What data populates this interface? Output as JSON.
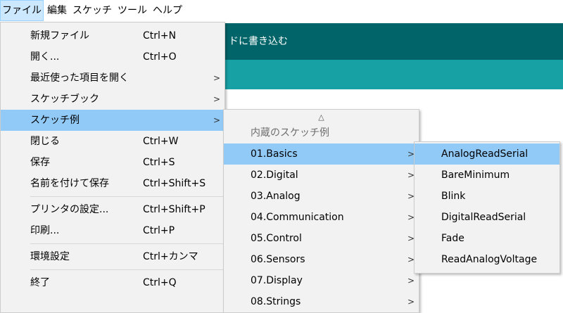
{
  "menubar": {
    "items": [
      {
        "label": "ファイル",
        "active": true
      },
      {
        "label": "編集",
        "active": false
      },
      {
        "label": "スケッチ",
        "active": false
      },
      {
        "label": "ツール",
        "active": false
      },
      {
        "label": "ヘルプ",
        "active": false
      }
    ]
  },
  "app": {
    "toolbar_tooltip": "ドに書き込む",
    "colors": {
      "toolbar": "#006468",
      "tabs": "#17a1a5",
      "highlight": "#91c9f7"
    }
  },
  "file_menu": {
    "items": [
      {
        "label": "新規ファイル",
        "shortcut": "Ctrl+N"
      },
      {
        "label": "開く...",
        "shortcut": "Ctrl+O"
      },
      {
        "label": "最近使った項目を開く",
        "shortcut": "",
        "submenu": true
      },
      {
        "label": "スケッチブック",
        "shortcut": "",
        "submenu": true
      },
      {
        "label": "スケッチ例",
        "shortcut": "",
        "submenu": true,
        "highlighted": true
      },
      {
        "label": "閉じる",
        "shortcut": "Ctrl+W"
      },
      {
        "label": "保存",
        "shortcut": "Ctrl+S"
      },
      {
        "label": "名前を付けて保存",
        "shortcut": "Ctrl+Shift+S"
      },
      {
        "label": "プリンタの設定...",
        "shortcut": "Ctrl+Shift+P"
      },
      {
        "label": "印刷...",
        "shortcut": "Ctrl+P"
      },
      {
        "label": "環境設定",
        "shortcut": "Ctrl+カンマ"
      },
      {
        "label": "終了",
        "shortcut": "Ctrl+Q"
      }
    ]
  },
  "examples_menu": {
    "scroll_up_arrow": "△",
    "header": "内蔵のスケッチ例",
    "items": [
      {
        "label": "01.Basics",
        "highlighted": true
      },
      {
        "label": "02.Digital"
      },
      {
        "label": "03.Analog"
      },
      {
        "label": "04.Communication"
      },
      {
        "label": "05.Control"
      },
      {
        "label": "06.Sensors"
      },
      {
        "label": "07.Display"
      },
      {
        "label": "08.Strings"
      }
    ],
    "submenu_arrow": ">"
  },
  "basics_menu": {
    "items": [
      {
        "label": "AnalogReadSerial",
        "highlighted": true
      },
      {
        "label": "BareMinimum"
      },
      {
        "label": "Blink"
      },
      {
        "label": "DigitalReadSerial"
      },
      {
        "label": "Fade"
      },
      {
        "label": "ReadAnalogVoltage"
      }
    ]
  }
}
